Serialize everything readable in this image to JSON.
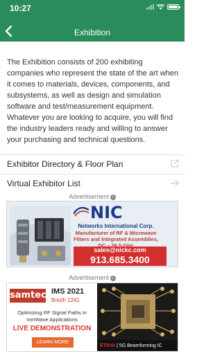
{
  "status": {
    "time": "10:27"
  },
  "header": {
    "title": "Exhibition",
    "back_icon": "chevron-left-icon",
    "bg_color": "#2a8c5a"
  },
  "intro": {
    "text": "The Exhibition consists of 200 exhibiting companies who represent the state of the art when it comes to materials, devices, components, and subsystems, as well as design and simulation software and test/measurement equipment. Whatever you are looking to acquire, you will find the industry leaders ready and willing to answer your purchasing and technical questions."
  },
  "menu": {
    "items": [
      {
        "label": "Exhibitor Directory & Floor Plan",
        "icon": "external-link-icon"
      },
      {
        "label": "Virtual Exhibitor List",
        "icon": "arrow-right-icon"
      }
    ]
  },
  "ads": {
    "label": "Advertisement",
    "nic": {
      "brand": "NIC",
      "company": "Networks International Corp.",
      "line1": "Manufacturer of RF & Microwave",
      "line2": "Filters and Integrated Assemblies,",
      "line3": "DC – 26.5 GHz",
      "email": "sales@nickc.com",
      "phone": "913.685.3400"
    },
    "samtec": {
      "brand": "samtec",
      "event": "IMS 2021",
      "booth": "Booth 1241",
      "line1": "Optimizing RF Signal Paths in",
      "line2": "mmWave Applications",
      "live": "LIVE DEMONSTRATION",
      "button": "LEARN MORE",
      "partner": "ETAVA",
      "tagline": "5G Beamforming IC"
    }
  }
}
